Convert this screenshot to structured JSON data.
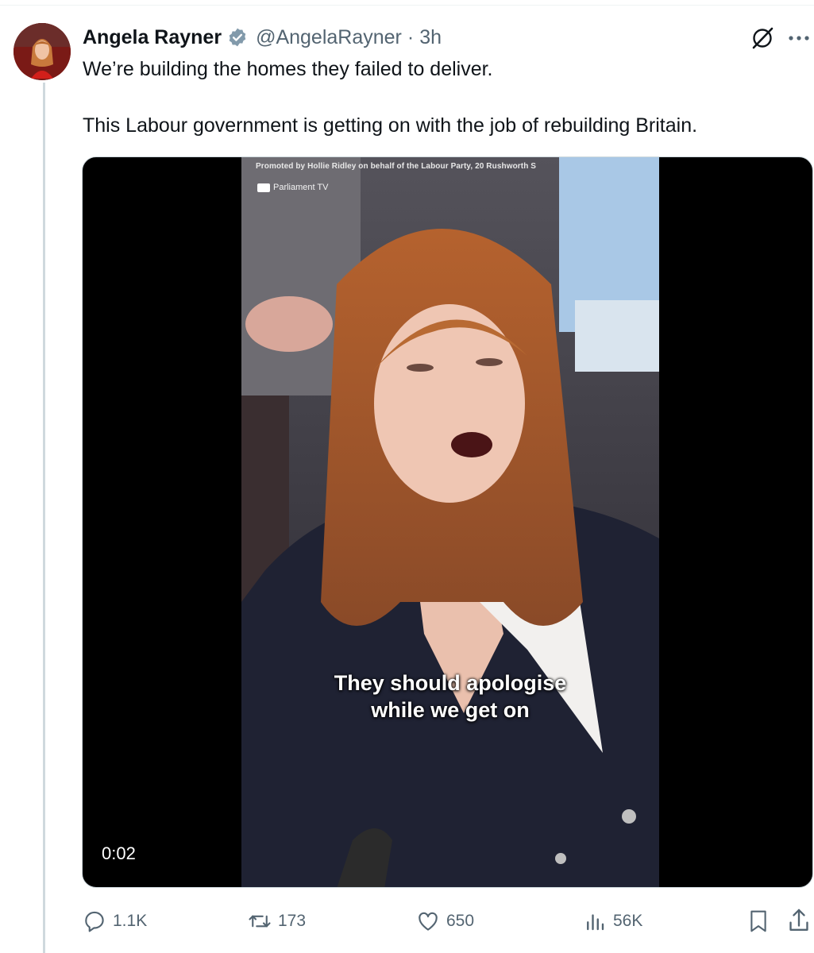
{
  "tweet": {
    "author_name": "Angela Rayner",
    "handle": "@AngelaRayner",
    "separator": "·",
    "time": "3h",
    "text_line1": "We’re building the homes they failed to deliver.",
    "text_line2": "This Labour government is getting on with the job of rebuilding Britain."
  },
  "video": {
    "promoted_text": "Promoted by Hollie Ridley on behalf of the Labour Party, 20 Rushworth S",
    "channel_label": "Parliament TV",
    "caption_line1": "They should apologise",
    "caption_line2": "while we get on",
    "timestamp": "0:02"
  },
  "actions": {
    "replies": "1.1K",
    "reposts": "173",
    "likes": "650",
    "views": "56K"
  },
  "icons": [
    "verified-badge-icon",
    "grok-icon",
    "more-icon",
    "reply-icon",
    "repost-icon",
    "like-icon",
    "views-icon",
    "bookmark-icon",
    "share-icon"
  ],
  "colors": {
    "text_primary": "#0f1419",
    "text_secondary": "#536471",
    "verified_blue": "#829aab"
  }
}
